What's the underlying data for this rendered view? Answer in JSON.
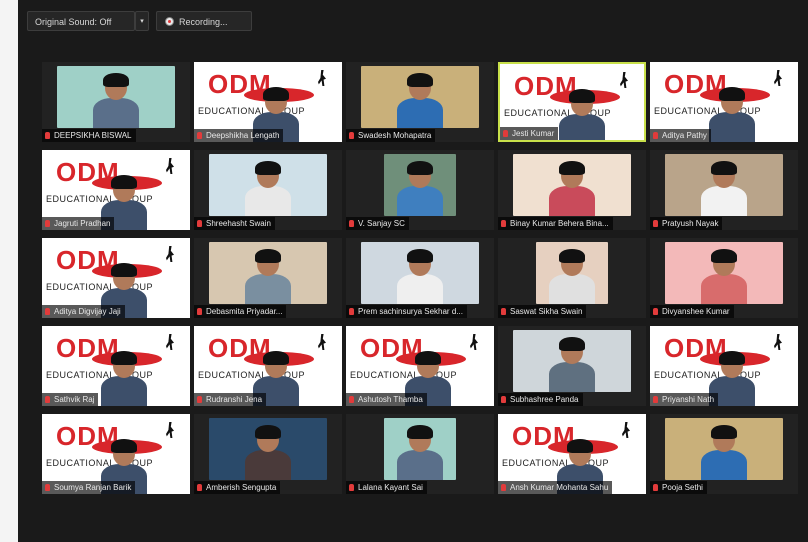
{
  "toolbar": {
    "sound_label": "Original Sound: Off",
    "sound_caret": "▾",
    "recording_label": "Recording..."
  },
  "participants": [
    {
      "name": "DEEPSIKHA BISWAL",
      "kind": "cam"
    },
    {
      "name": "Deepshikha Lengath",
      "kind": "logo"
    },
    {
      "name": "Swadesh Mohapatra",
      "kind": "cam"
    },
    {
      "name": "Jesti Kumar",
      "kind": "logo",
      "active": true
    },
    {
      "name": "Aditya Pathy",
      "kind": "logo"
    },
    {
      "name": "Jagruti Pradhan",
      "kind": "logo"
    },
    {
      "name": "Shreehasht Swain",
      "kind": "cam"
    },
    {
      "name": "V. Sanjay SC",
      "kind": "cam"
    },
    {
      "name": "Binay Kumar Behera Bina...",
      "kind": "cam"
    },
    {
      "name": "Pratyush Nayak",
      "kind": "cam"
    },
    {
      "name": "Aditya Digvijay Jaji",
      "kind": "logo"
    },
    {
      "name": "Debasmita Priyadar...",
      "kind": "cam"
    },
    {
      "name": "Prem sachinsurya Sekhar d...",
      "kind": "cam"
    },
    {
      "name": "Saswat Sikha Swain",
      "kind": "cam"
    },
    {
      "name": "Divyanshee Kumar",
      "kind": "cam"
    },
    {
      "name": "Sathvik Raj",
      "kind": "logo"
    },
    {
      "name": "Rudranshi Jena",
      "kind": "logo"
    },
    {
      "name": "Ashutosh Thamba",
      "kind": "logo"
    },
    {
      "name": "Subhashree Panda",
      "kind": "cam"
    },
    {
      "name": "Priyanshi Nath",
      "kind": "logo"
    },
    {
      "name": "Soumya Ranjan Barik",
      "kind": "logo"
    },
    {
      "name": "Amberish Sengupta",
      "kind": "cam"
    },
    {
      "name": "Lalana Kayant Sai",
      "kind": "cam"
    },
    {
      "name": "Ansh Kumar Mohanta Sahu",
      "kind": "logo"
    },
    {
      "name": "Pooja Sethi",
      "kind": "cam"
    }
  ],
  "logo": {
    "title": "ODM",
    "subtitle": "EDUCATIONAL GROUP"
  },
  "colors": {
    "brand_red": "#d8262b",
    "active_border": "#c8e04a",
    "mic_muted": "#e23b3b"
  }
}
